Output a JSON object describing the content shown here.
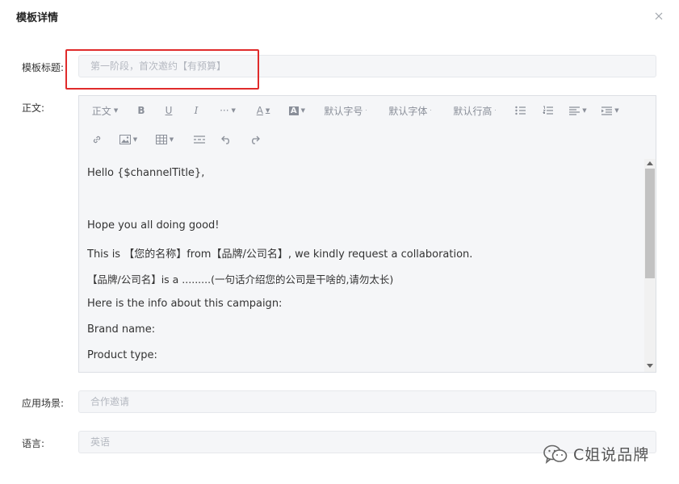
{
  "dialog": {
    "title": "模板详情"
  },
  "form": {
    "title_label": "模板标题:",
    "title_placeholder": "第一阶段，首次邀约【有预算】",
    "body_label": "正文:",
    "scene_label": "应用场景:",
    "scene_value": "合作邀请",
    "language_label": "语言:",
    "language_value": "英语"
  },
  "toolbar": {
    "paragraph": "正文",
    "bold": "B",
    "underline": "U",
    "italic": "I",
    "more": "···",
    "font_color": "A",
    "bg_color": "A",
    "font_size": "默认字号",
    "font_family": "默认字体",
    "line_height": "默认行高"
  },
  "editor": {
    "lines": [
      "Hello {$channelTitle},",
      "Hope you all doing good!",
      "This is 【您的名称】from【品牌/公司名】, we kindly request a collaboration.",
      "【品牌/公司名】is a .........(一句话介绍您的公司是干啥的,请勿太长)",
      "Here is the info about this campaign:",
      "Brand name:",
      "Product type:"
    ]
  },
  "watermark": {
    "text": "C姐说品牌"
  },
  "colors": {
    "highlight": "#e02b2b",
    "field_bg": "#f5f6f8",
    "placeholder": "#b4b8c0"
  }
}
